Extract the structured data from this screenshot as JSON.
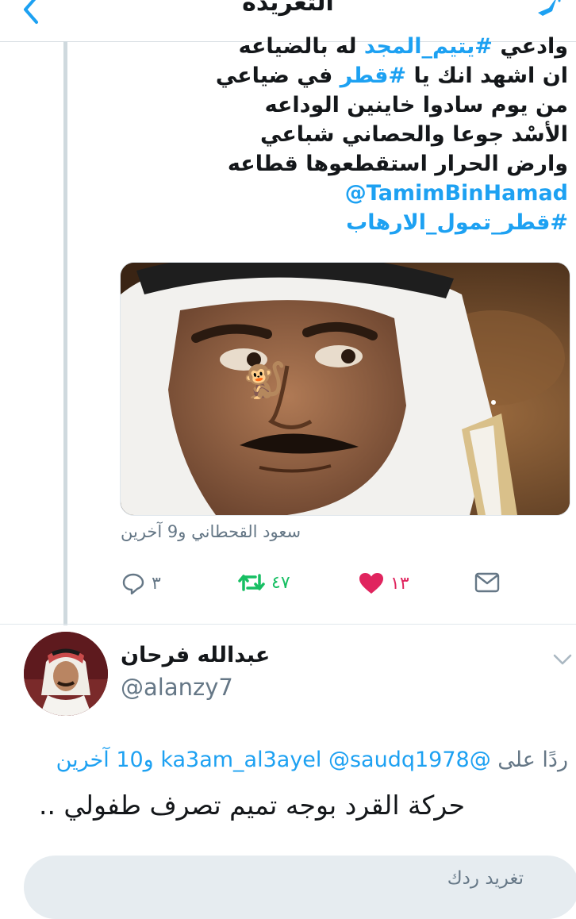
{
  "header": {
    "title": "التغريدة"
  },
  "tweet": {
    "lines": [
      "وادعي #يتيم_المجد له بالضياعه",
      "ان اشهد انك يا #قطر في ضياعي",
      "من يوم سادوا خاينين الوداعه",
      "الأسْد جوعا والحصاني شباعي",
      "وارض الحرار استقطعوها قطاعه"
    ],
    "line1_prefix": "وادعي ",
    "line1_tag": "#يتيم_المجد",
    "line1_suffix": " له بالضياعه",
    "line2_prefix": "ان اشهد انك يا ",
    "line2_tag": "#قطر",
    "line2_suffix": " في ضياعي",
    "line3": "من يوم سادوا خاينين الوداعه",
    "line4": "الأسْد جوعا والحصاني شباعي",
    "line5": "وارض الحرار استقطعوها قطاعه",
    "mention": "@TamimBinHamad",
    "hashtag": "#قطر_تمول_الارهاب",
    "tagged_people": "سعود القحطاني و9 آخرين",
    "media_emoji": "🐒"
  },
  "actions": {
    "reply_count": "٣",
    "retweet_count": "٤٧",
    "like_count": "١٣"
  },
  "reply": {
    "user_name": "عبدالله فرحان",
    "user_handle": "@alanzy7",
    "replying_label": "ردًا على",
    "replying_handles": "@ka3am_al3ayel @saudq1978",
    "replying_others": "و10 آخرين",
    "text": "حركة القرد بوجه تميم تصرف طفولي .."
  },
  "composer": {
    "placeholder": "تغريد ردك"
  },
  "colors": {
    "link": "#1da1f2",
    "retweet": "#17bf63",
    "like": "#e0245e",
    "muted": "#657786"
  },
  "icons": [
    "back-arrow-icon",
    "compose-icon",
    "reply-icon",
    "retweet-icon",
    "heart-icon",
    "mail-icon",
    "chevron-down-icon"
  ]
}
